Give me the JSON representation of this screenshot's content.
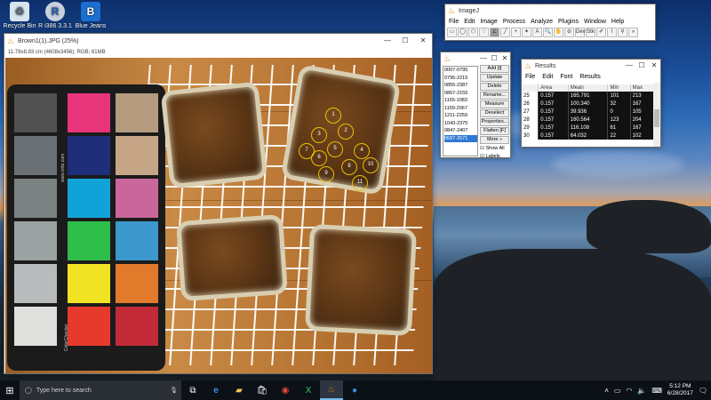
{
  "desktop": {
    "icons": [
      {
        "label": "Recycle Bin",
        "icon": "recycle-bin-icon"
      },
      {
        "label": "R i386 3.3.1",
        "icon": "r-app-icon"
      },
      {
        "label": "Blue Jeans",
        "icon": "bluejeans-icon"
      }
    ]
  },
  "image_window": {
    "title": "Brown1(1).JPG (25%)",
    "info": "11.78x8.83 cm (4608x3456); RGB; 61MB",
    "card_text_1": "www.xrite.com",
    "card_text_2": "ColorChecker",
    "roi_labels": [
      "1",
      "2",
      "3",
      "4",
      "5",
      "6",
      "7",
      "8",
      "9",
      "10",
      "11"
    ]
  },
  "imagej": {
    "title": "ImageJ",
    "menu": [
      "File",
      "Edit",
      "Image",
      "Process",
      "Analyze",
      "Plugins",
      "Window",
      "Help"
    ],
    "tools": [
      "▭",
      "◯",
      "⬠",
      "♡",
      "∠",
      "╱",
      "+",
      "✦",
      "A",
      "🔍",
      "✋",
      "⊘",
      "Dev",
      "Stk",
      "✐",
      "⌇",
      "⚲",
      "»"
    ]
  },
  "roi_manager": {
    "list": [
      "0007-0795",
      "0795-2215",
      "0855-2387",
      "0867-2155",
      "1155-1083",
      "1159-2067",
      "1211-2259",
      "1043-2375",
      "0847-2407",
      "0687-2571"
    ],
    "selected_index": 9,
    "buttons": [
      "Add [t]",
      "Update",
      "Delete",
      "Rename...",
      "Measure",
      "Deselect",
      "Properties...",
      "Flatten [F]",
      "More »"
    ],
    "show_all": "Show All",
    "labels": "Labels"
  },
  "results": {
    "title": "Results",
    "menu": [
      "File",
      "Edit",
      "Font",
      "Results"
    ],
    "columns": [
      "",
      "Area",
      "Mean",
      "Min",
      "Max"
    ],
    "rows": [
      [
        "25",
        "0.157",
        "165.791",
        "101",
        "213"
      ],
      [
        "26",
        "0.157",
        "100.340",
        "32",
        "167"
      ],
      [
        "27",
        "0.157",
        "39.936",
        "0",
        "105"
      ],
      [
        "28",
        "0.157",
        "160.564",
        "123",
        "204"
      ],
      [
        "29",
        "0.157",
        "116.108",
        "61",
        "167"
      ],
      [
        "30",
        "0.157",
        "64.032",
        "22",
        "102"
      ]
    ]
  },
  "taskbar": {
    "search_placeholder": "Type here to search",
    "time": "5:12 PM",
    "date": "6/28/2017"
  },
  "colors": {
    "accent": "#76b9ed",
    "roi": "#e8c200",
    "selection": "#2f79d6"
  }
}
